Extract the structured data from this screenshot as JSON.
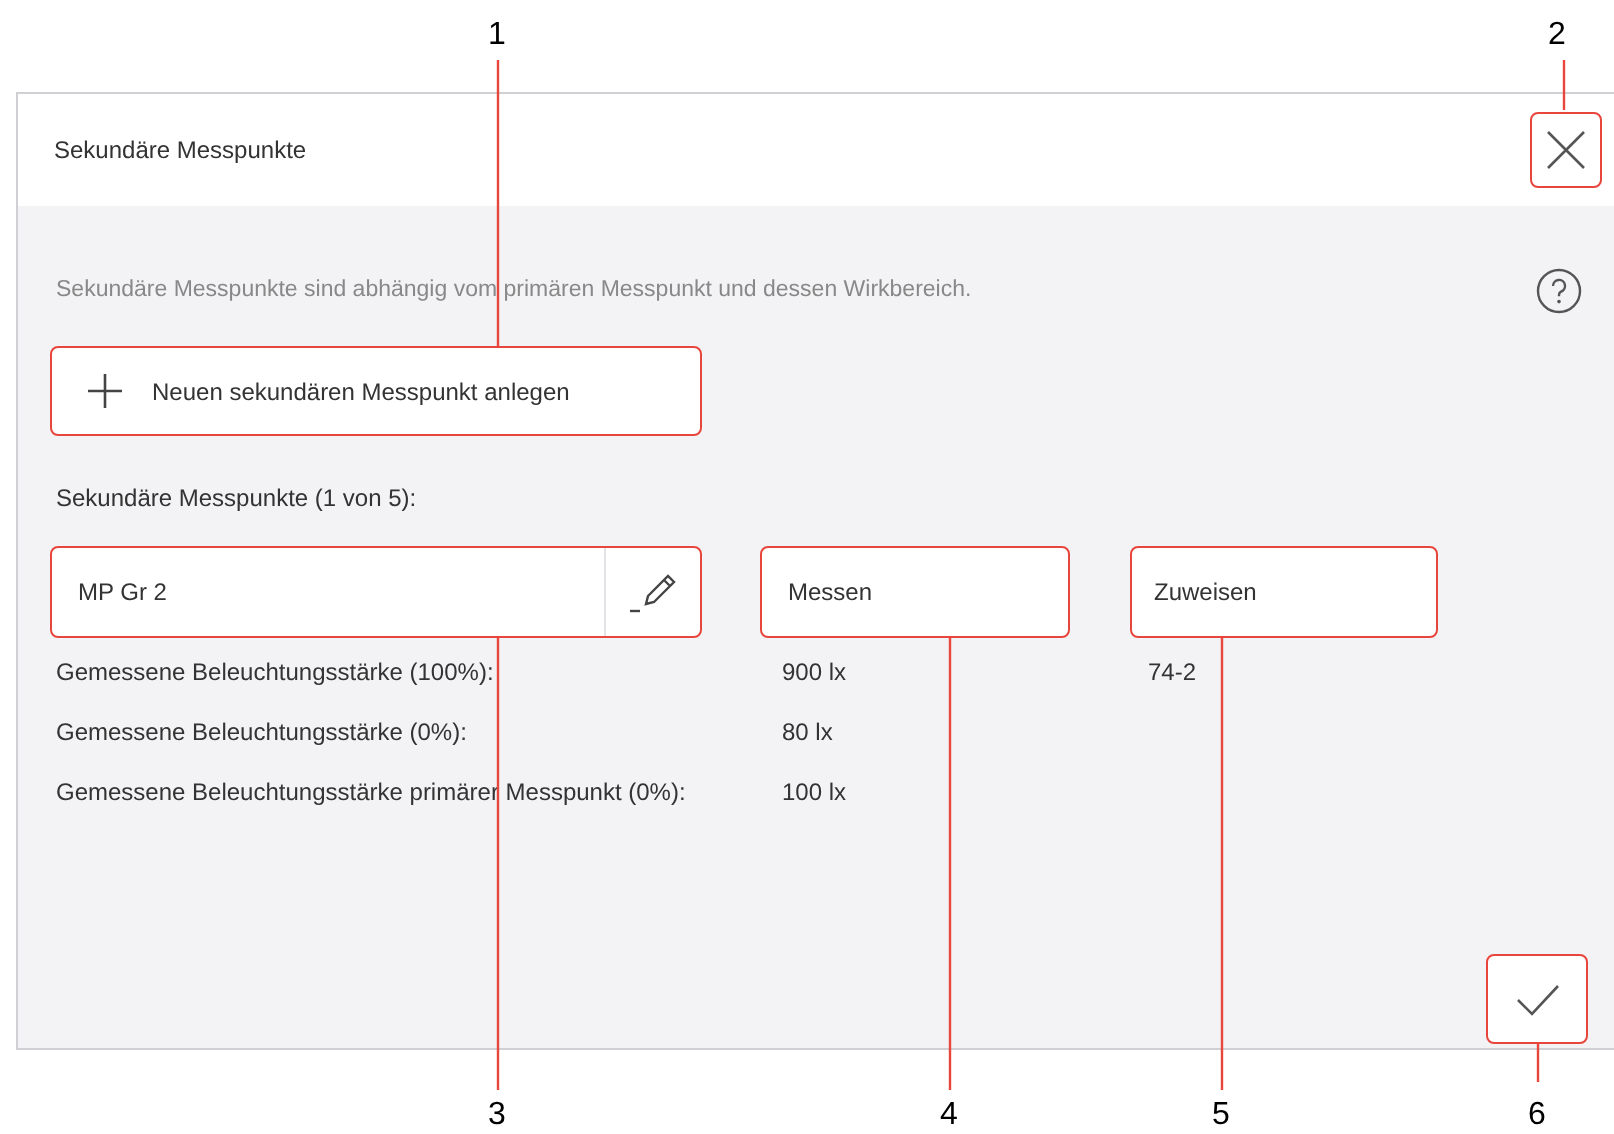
{
  "dialog": {
    "title": "Sekundäre Messpunkte",
    "description": "Sekundäre Messpunkte sind abhängig vom primären Messpunkt und dessen Wirkbereich.",
    "add_button": {
      "label": "Neuen sekundären Messpunkt anlegen"
    },
    "list_label": "Sekundäre Messpunkte (1 von 5):",
    "measuring_point": {
      "name": "MP Gr 2"
    },
    "measure_button": {
      "label": "Messen"
    },
    "assign_button": {
      "label": "Zuweisen"
    },
    "readings": [
      {
        "label": "Gemessene Beleuchtungsstärke (100%):",
        "value": "900 lx",
        "column_3": "74-2"
      },
      {
        "label": "Gemessene Beleuchtungsstärke (0%):",
        "value": "80 lx"
      },
      {
        "label": "Gemessene Beleuchtungsstärke primärer Messpunkt (0%):",
        "value": "100 lx"
      }
    ]
  },
  "callouts": [
    {
      "label": "1"
    },
    {
      "label": "2"
    },
    {
      "label": "3"
    },
    {
      "label": "4"
    },
    {
      "label": "5"
    },
    {
      "label": "6"
    }
  ]
}
